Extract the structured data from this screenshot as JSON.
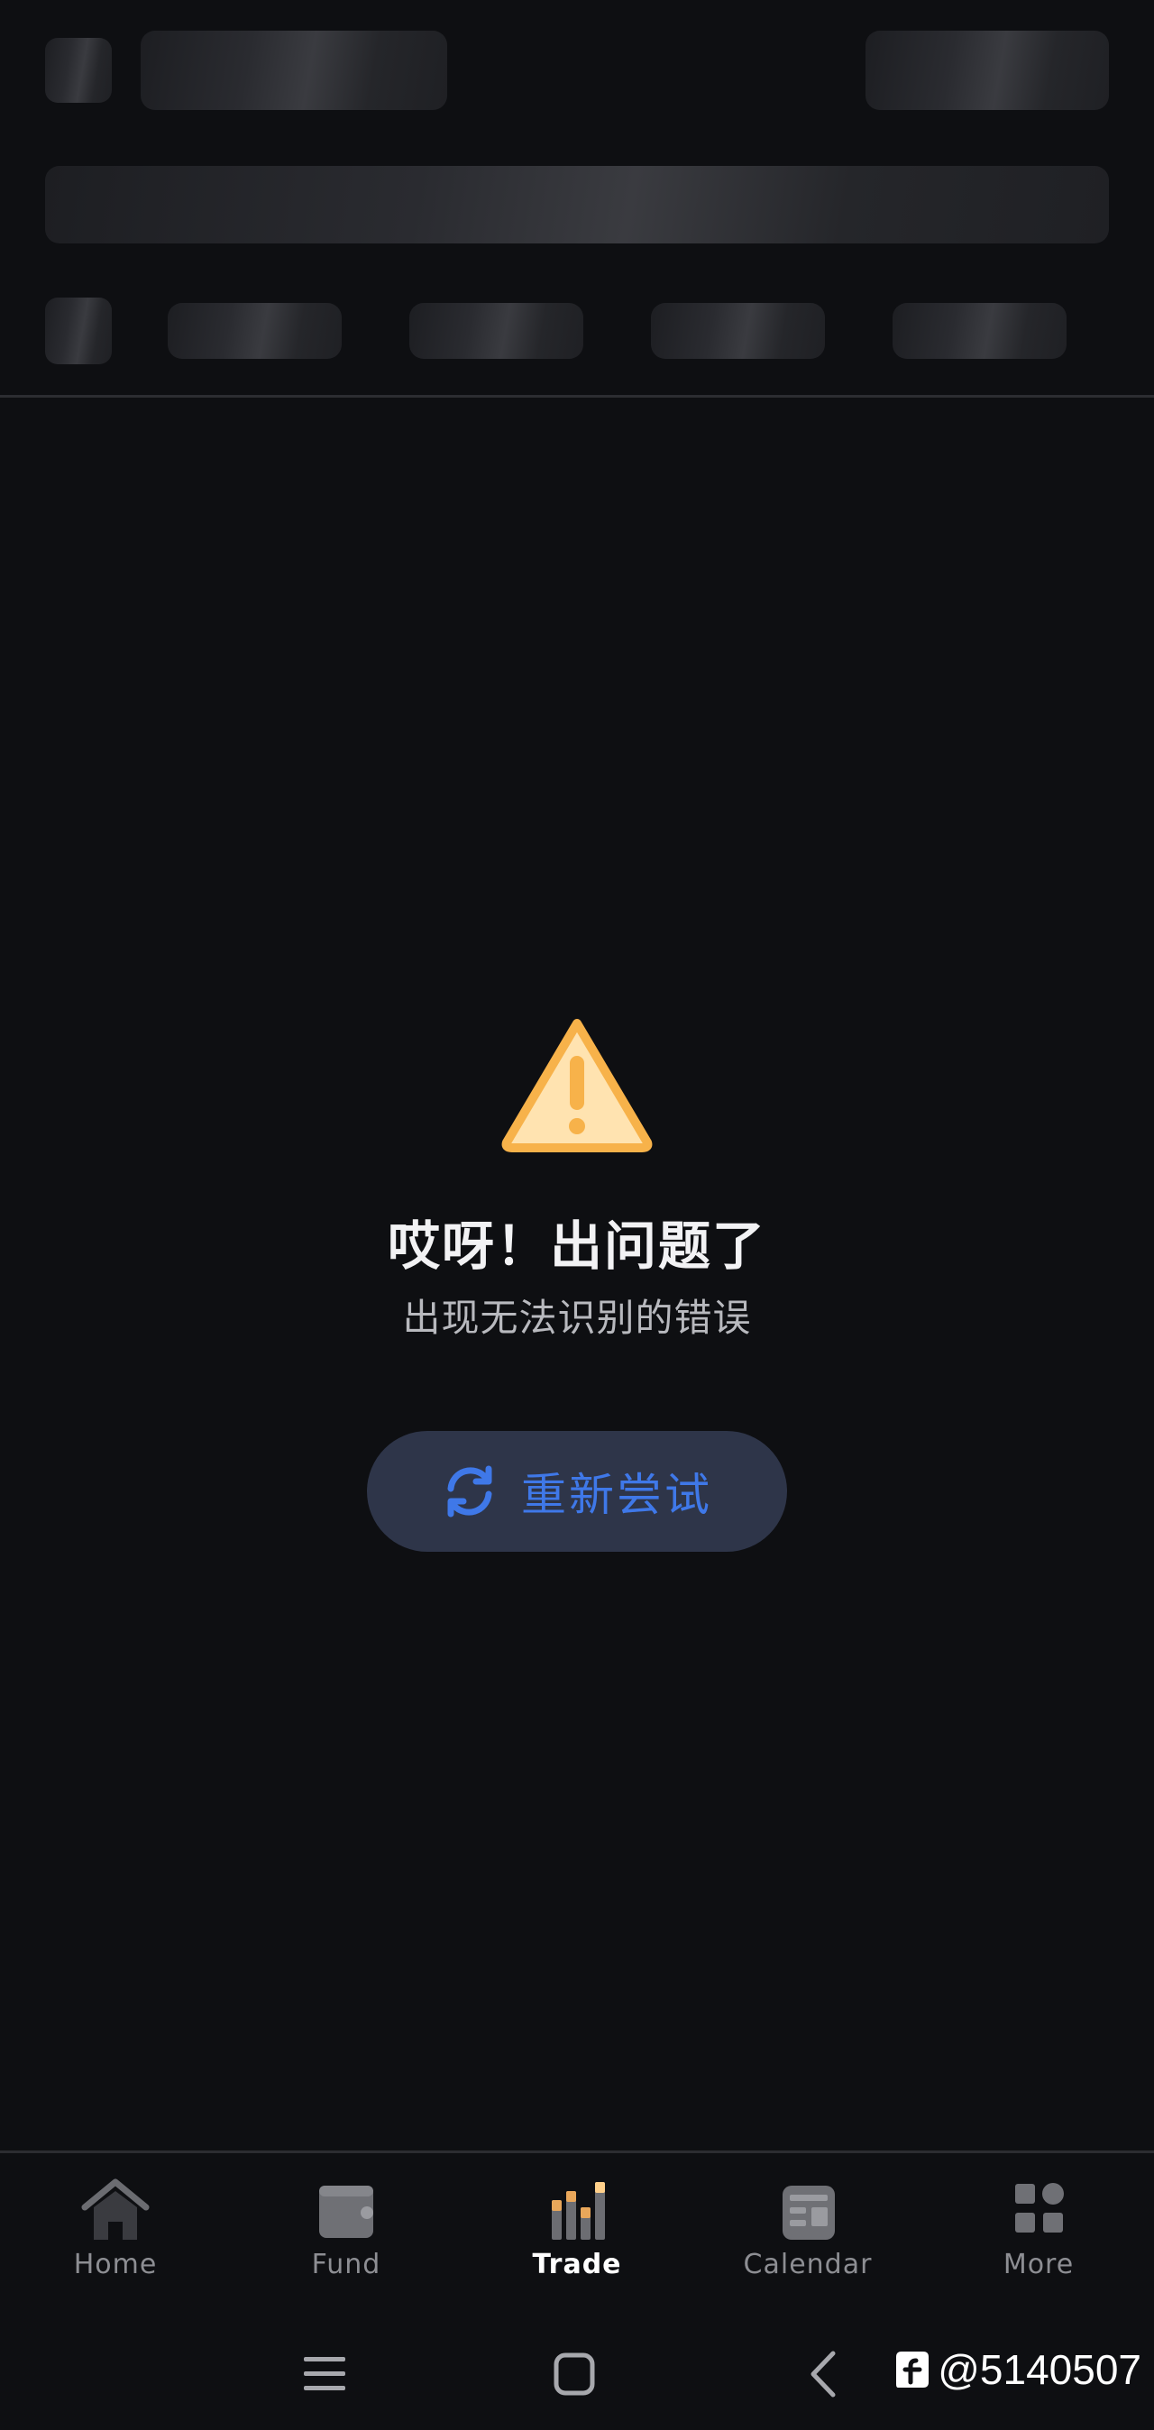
{
  "error": {
    "title": "哎呀！出问题了",
    "subtitle": "出现无法识别的错误",
    "retry_label": "重新尝试",
    "icon": "warning-triangle-icon",
    "retry_icon": "refresh-icon"
  },
  "tabbar": {
    "active": "Trade",
    "items": [
      {
        "label": "Home",
        "icon": "home-icon"
      },
      {
        "label": "Fund",
        "icon": "wallet-icon"
      },
      {
        "label": "Trade",
        "icon": "bar-chart-icon"
      },
      {
        "label": "Calendar",
        "icon": "calendar-news-icon"
      },
      {
        "label": "More",
        "icon": "grid-icon"
      }
    ]
  },
  "system_nav": {
    "items": [
      {
        "icon": "menu-icon"
      },
      {
        "icon": "home-square-icon"
      },
      {
        "icon": "back-icon"
      }
    ]
  },
  "watermark": {
    "text": "@5140507",
    "icon": "weibo-logo"
  },
  "colors": {
    "background": "#0e0f12",
    "accent_blue": "#3f78e8",
    "warning_fill": "#ffe3b0",
    "warning_stroke": "#f7b24a",
    "tab_inactive": "#8d8e93",
    "tab_active": "#ffffff"
  }
}
